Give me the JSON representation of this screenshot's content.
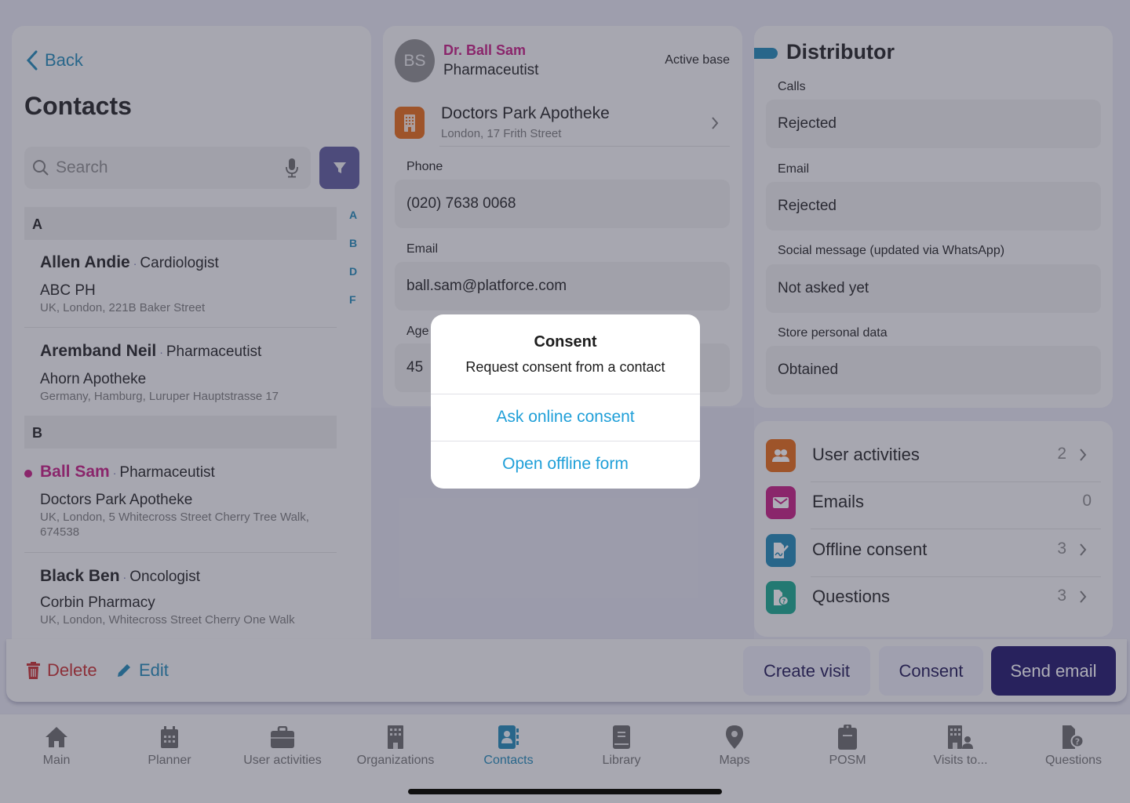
{
  "left": {
    "back_label": "Back",
    "title": "Contacts",
    "search_placeholder": "Search",
    "alpha_index": [
      "A",
      "B",
      "D",
      "F"
    ],
    "sections": [
      {
        "letter": "A"
      },
      {
        "letter": "B"
      }
    ],
    "contacts": [
      {
        "name": "Allen Andie",
        "specialty": "Cardiologist",
        "org": "ABC PH",
        "address": "UK, London, 221B Baker Street",
        "selected": false
      },
      {
        "name": "Aremband Neil",
        "specialty": "Pharmaceutist",
        "org": "Ahorn Apotheke",
        "address": "Germany, Hamburg, Luruper Hauptstrasse 17",
        "selected": false
      },
      {
        "name": "Ball Sam",
        "specialty": "Pharmaceutist",
        "org": "Doctors Park Apotheke",
        "address": "UK, London, 5 Whitecross Street Cherry Tree Walk, 674538",
        "selected": true
      },
      {
        "name": "Black Ben",
        "specialty": "Oncologist",
        "org": "Corbin Pharmacy",
        "address": "UK, London, Whitecross Street Cherry One Walk",
        "selected": false
      }
    ],
    "separator": "·"
  },
  "detail": {
    "avatar_initials": "BS",
    "name": "Dr. Ball Sam",
    "specialty": "Pharmaceutist",
    "status": "Active base",
    "organization": {
      "name": "Doctors Park Apotheke",
      "address": "London, 17 Frith Street"
    },
    "fields": [
      {
        "label": "Phone",
        "value": "(020) 7638 0068"
      },
      {
        "label": "Email",
        "value": "ball.sam@platforce.com"
      },
      {
        "label": "Age",
        "value": "45"
      }
    ]
  },
  "distributor": {
    "title": "Distributor",
    "fields": [
      {
        "label": "Calls",
        "value": "Rejected"
      },
      {
        "label": "Email",
        "value": "Rejected"
      },
      {
        "label": "Social message (updated via WhatsApp)",
        "value": "Not asked yet"
      },
      {
        "label": "Store personal data",
        "value": "Obtained"
      }
    ]
  },
  "links": [
    {
      "label": "User activities",
      "count": "2",
      "icon": "users-icon",
      "color": "#e5660f",
      "chevron": true
    },
    {
      "label": "Emails",
      "count": "0",
      "icon": "envelope-icon",
      "color": "#c3177f",
      "chevron": false
    },
    {
      "label": "Offline consent",
      "count": "3",
      "icon": "signed-document-icon",
      "color": "#1b86b4",
      "chevron": true
    },
    {
      "label": "Questions",
      "count": "3",
      "icon": "question-document-icon",
      "color": "#12a58a",
      "chevron": true
    }
  ],
  "actions": {
    "delete": "Delete",
    "edit": "Edit",
    "create_visit": "Create visit",
    "consent": "Consent",
    "send_email": "Send email"
  },
  "tabs": [
    {
      "label": "Main",
      "icon": "home-icon",
      "active": false
    },
    {
      "label": "Planner",
      "icon": "calendar-icon",
      "active": false
    },
    {
      "label": "User activities",
      "icon": "briefcase-icon",
      "active": false
    },
    {
      "label": "Organizations",
      "icon": "building-icon",
      "active": false
    },
    {
      "label": "Contacts",
      "icon": "contact-book-icon",
      "active": true
    },
    {
      "label": "Library",
      "icon": "book-icon",
      "active": false
    },
    {
      "label": "Maps",
      "icon": "map-pin-icon",
      "active": false
    },
    {
      "label": "POSM",
      "icon": "clipboard-icon",
      "active": false
    },
    {
      "label": "Visits to...",
      "icon": "building-person-icon",
      "active": false
    },
    {
      "label": "Questions",
      "icon": "question-document-icon",
      "active": false
    }
  ],
  "modal": {
    "title": "Consent",
    "message": "Request consent from a contact",
    "options": [
      "Ask online consent",
      "Open offline form"
    ]
  },
  "colors": {
    "accent": "#1b86b4",
    "highlight": "#c3177f",
    "primary_button": "#1a1166",
    "filter_button": "#5a5699",
    "delete": "#c62828"
  }
}
